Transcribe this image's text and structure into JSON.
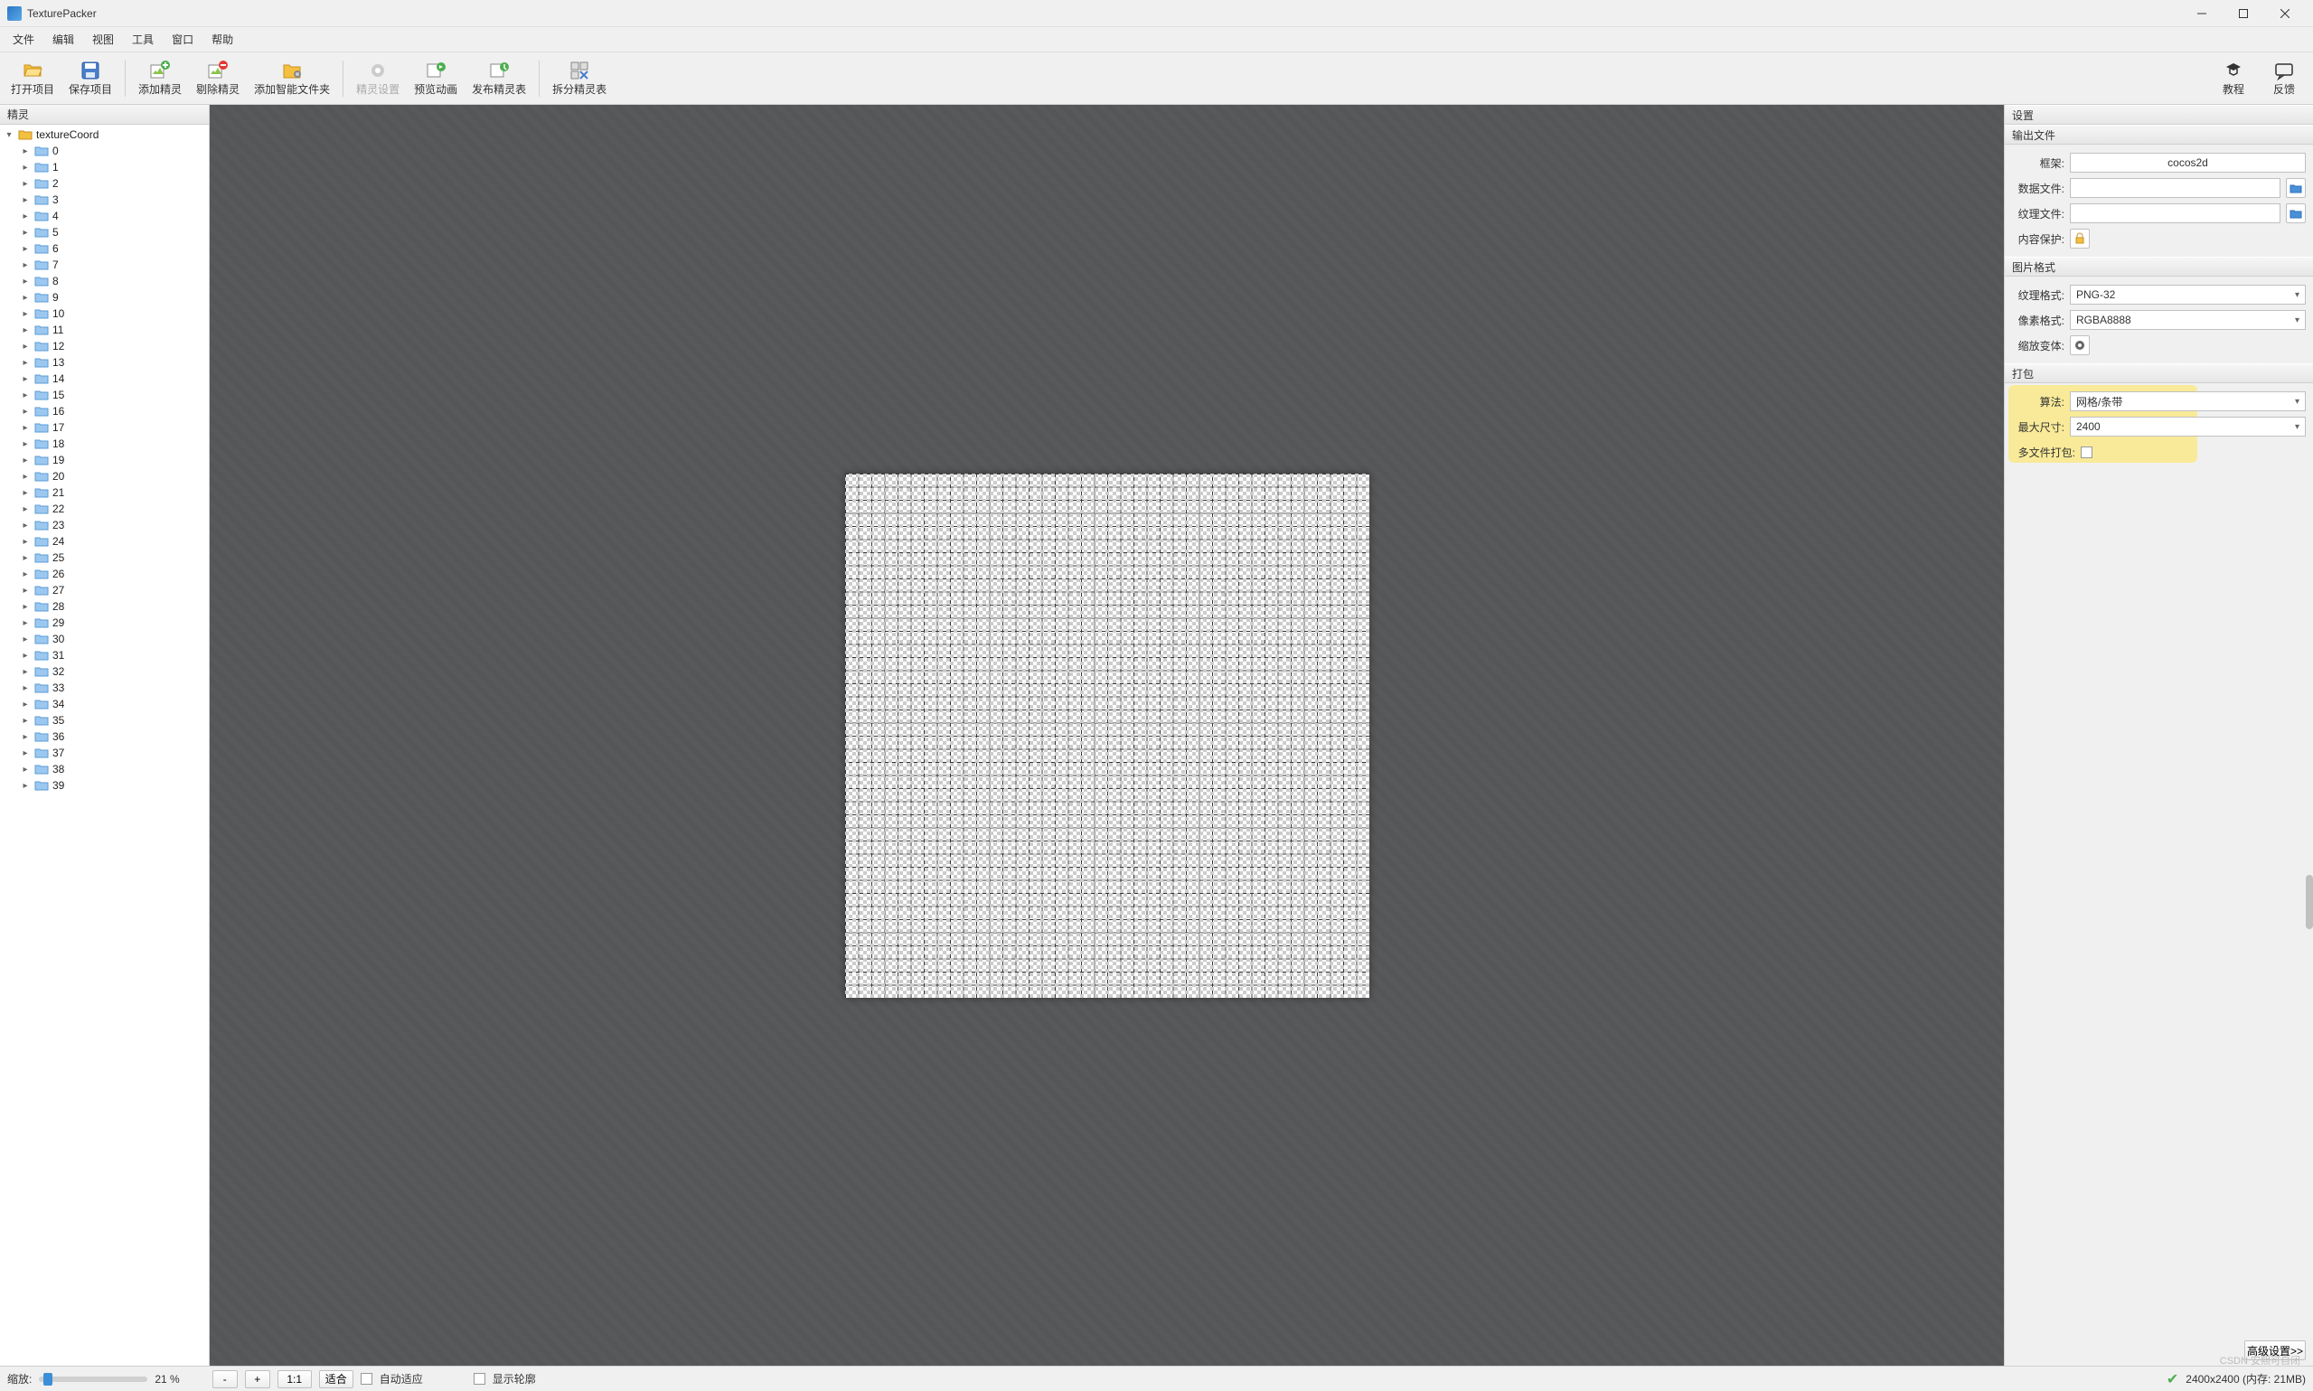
{
  "window": {
    "title": "TexturePacker"
  },
  "menu": {
    "items": [
      "文件",
      "编辑",
      "视图",
      "工具",
      "窗口",
      "帮助"
    ]
  },
  "toolbar": {
    "open_project": "打开项目",
    "save_project": "保存项目",
    "add_sprite": "添加精灵",
    "remove_sprite": "剔除精灵",
    "add_smart_folder": "添加智能文件夹",
    "sprite_settings": "精灵设置",
    "preview_anim": "预览动画",
    "publish_sheet": "发布精灵表",
    "split_sheet": "拆分精灵表",
    "tutorial": "教程",
    "feedback": "反馈"
  },
  "left": {
    "title": "精灵",
    "root": "textureCoord",
    "folders": [
      "0",
      "1",
      "2",
      "3",
      "4",
      "5",
      "6",
      "7",
      "8",
      "9",
      "10",
      "11",
      "12",
      "13",
      "14",
      "15",
      "16",
      "17",
      "18",
      "19",
      "20",
      "21",
      "22",
      "23",
      "24",
      "25",
      "26",
      "27",
      "28",
      "29",
      "30",
      "31",
      "32",
      "33",
      "34",
      "35",
      "36",
      "37",
      "38",
      "39"
    ]
  },
  "right": {
    "settings_title": "设置",
    "output": {
      "title": "输出文件",
      "framework_label": "框架:",
      "framework_value": "cocos2d",
      "data_file_label": "数据文件:",
      "data_file_value": "",
      "texture_file_label": "纹理文件:",
      "texture_file_value": "",
      "protect_label": "内容保护:"
    },
    "image_format": {
      "title": "图片格式",
      "texture_fmt_label": "纹理格式:",
      "texture_fmt_value": "PNG-32",
      "pixel_fmt_label": "像素格式:",
      "pixel_fmt_value": "RGBA8888",
      "scale_var_label": "缩放变体:"
    },
    "packing": {
      "title": "打包",
      "algo_label": "算法:",
      "algo_value": "网格/条带",
      "max_size_label": "最大尺寸:",
      "max_size_value": "2400",
      "multipack_label": "多文件打包:"
    },
    "advanced_btn": "高级设置>>"
  },
  "status": {
    "zoom_label": "缩放:",
    "zoom_value": "21 %",
    "minus": "-",
    "plus": "+",
    "one_to_one": "1:1",
    "fit": "适合",
    "auto_fit": "自动适应",
    "show_outline": "显示轮廓",
    "size_mem": "2400x2400 (内存: 21MB)"
  },
  "watermark": "CSDN 安熙可自闭"
}
